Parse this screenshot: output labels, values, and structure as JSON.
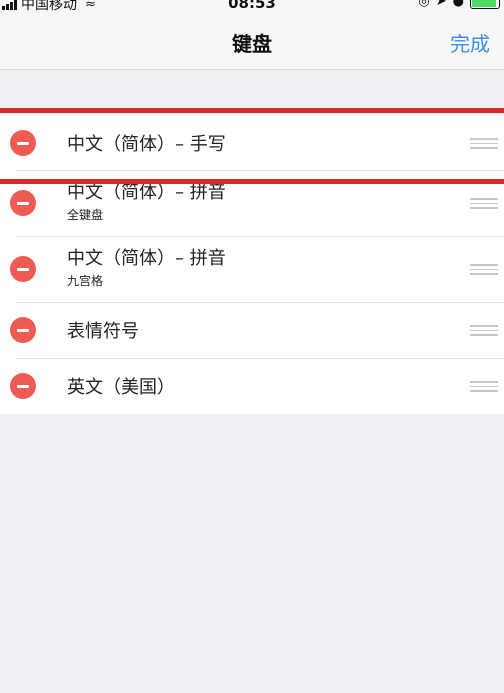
{
  "status_bar": {
    "carrier": "中国移动",
    "time": "08:53",
    "wifi_icon": "wifi-icon",
    "battery_level": 0.9,
    "battery_color": "#4cd964"
  },
  "nav": {
    "title": "键盘",
    "done_label": "完成"
  },
  "keyboards": [
    {
      "title": "中文（简体）– 手写",
      "subtitle": ""
    },
    {
      "title": "中文（简体）– 拼音",
      "subtitle": "全键盘"
    },
    {
      "title": "中文（简体）– 拼音",
      "subtitle": "九宫格"
    },
    {
      "title": "表情符号",
      "subtitle": ""
    },
    {
      "title": "英文（美国）",
      "subtitle": ""
    }
  ],
  "colors": {
    "accent": "#3d8ee6",
    "delete": "#ee5b52",
    "highlight": "#d62a2a",
    "background": "#efeff4"
  }
}
